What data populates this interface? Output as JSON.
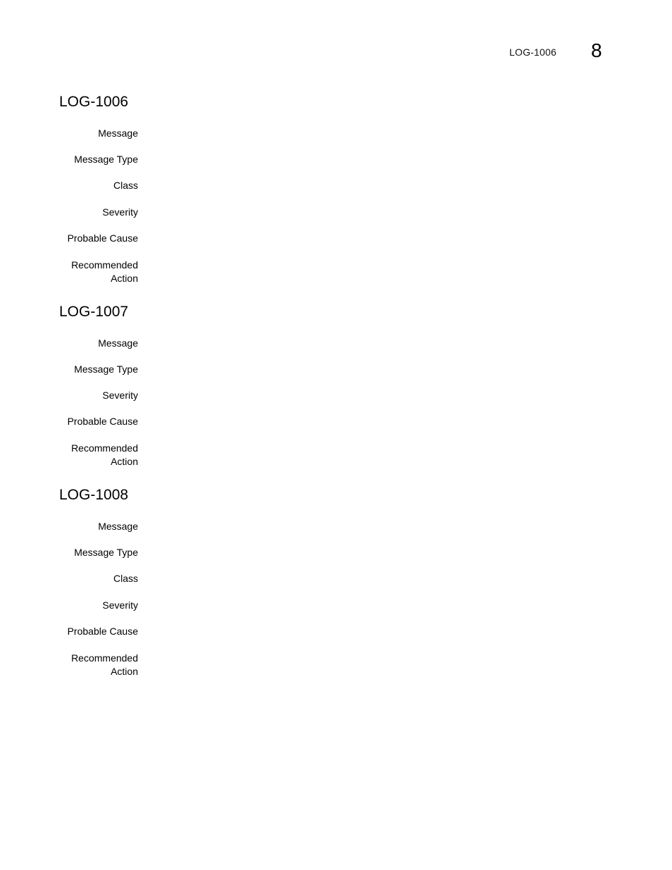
{
  "header": {
    "running_title": "LOG-1006",
    "chapter_number": "8"
  },
  "sections": [
    {
      "title": "LOG-1006",
      "fields": [
        {
          "label": "Message",
          "value": ""
        },
        {
          "label": "Message Type",
          "value": ""
        },
        {
          "label": "Class",
          "value": ""
        },
        {
          "label": "Severity",
          "value": ""
        },
        {
          "label": "Probable Cause",
          "value": ""
        },
        {
          "label": "Recommended Action",
          "value": ""
        }
      ]
    },
    {
      "title": "LOG-1007",
      "fields": [
        {
          "label": "Message",
          "value": ""
        },
        {
          "label": "Message Type",
          "value": ""
        },
        {
          "label": "Severity",
          "value": ""
        },
        {
          "label": "Probable Cause",
          "value": ""
        },
        {
          "label": "Recommended Action",
          "value": ""
        }
      ]
    },
    {
      "title": "LOG-1008",
      "fields": [
        {
          "label": "Message",
          "value": ""
        },
        {
          "label": "Message Type",
          "value": ""
        },
        {
          "label": "Class",
          "value": ""
        },
        {
          "label": "Severity",
          "value": ""
        },
        {
          "label": "Probable Cause",
          "value": ""
        },
        {
          "label": "Recommended Action",
          "value": ""
        }
      ]
    }
  ]
}
